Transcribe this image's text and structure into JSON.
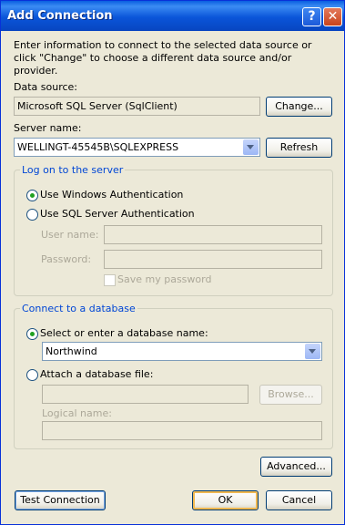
{
  "window": {
    "title": "Add Connection",
    "help_glyph": "?",
    "close_glyph": "✕"
  },
  "intro_text": "Enter information to connect to the selected data source or click \"Change\" to choose a different data source and/or provider.",
  "data_source": {
    "label": "Data source:",
    "value": "Microsoft SQL Server (SqlClient)",
    "change_label": "Change..."
  },
  "server": {
    "label": "Server name:",
    "value": "WELLINGT-45545B\\SQLEXPRESS",
    "refresh_label": "Refresh"
  },
  "logon": {
    "legend": "Log on to the server",
    "windows_auth_label": "Use Windows Authentication",
    "sql_auth_label": "Use SQL Server Authentication",
    "username_label": "User name:",
    "username_value": "",
    "password_label": "Password:",
    "password_value": "",
    "save_password_label": "Save my password",
    "selected": "windows"
  },
  "database": {
    "legend": "Connect to a database",
    "select_label": "Select or enter a database name:",
    "database_value": "Northwind",
    "attach_label": "Attach a database file:",
    "attach_value": "",
    "browse_label": "Browse...",
    "logical_label": "Logical name:",
    "logical_value": "",
    "selected": "select"
  },
  "buttons": {
    "advanced": "Advanced...",
    "test_connection": "Test Connection",
    "ok": "OK",
    "cancel": "Cancel"
  },
  "colors": {
    "title_bar": "#0a55d9",
    "group_legend": "#0046d5",
    "dialog_bg": "#ece9d8"
  }
}
